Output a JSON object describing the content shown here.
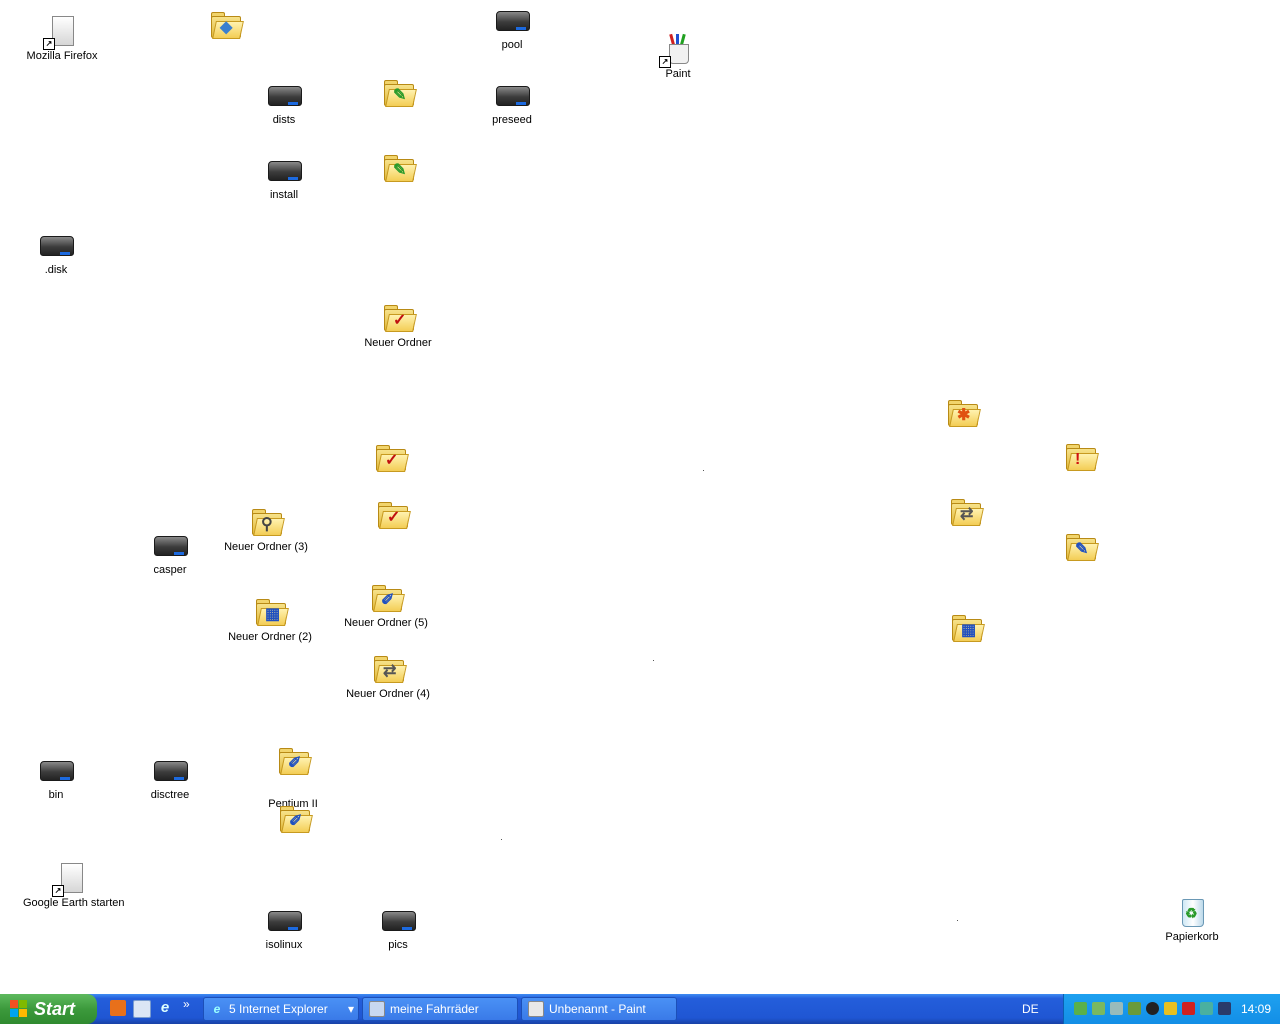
{
  "desktop": {
    "icons": [
      {
        "label": "Mozilla Firefox",
        "kind": "shortcut"
      },
      {
        "label": "",
        "kind": "folder-blue"
      },
      {
        "label": "pool",
        "kind": "drive"
      },
      {
        "label": "Paint",
        "kind": "paint"
      },
      {
        "label": "dists",
        "kind": "drive"
      },
      {
        "label": "",
        "kind": "folder-green"
      },
      {
        "label": "preseed",
        "kind": "drive"
      },
      {
        "label": "install",
        "kind": "drive"
      },
      {
        "label": "",
        "kind": "folder-green"
      },
      {
        "label": ".disk",
        "kind": "drive"
      },
      {
        "label": "Neuer Ordner",
        "kind": "folder-check"
      },
      {
        "label": "",
        "kind": "folder-star"
      },
      {
        "label": "",
        "kind": "folder-error"
      },
      {
        "label": "",
        "kind": "folder-check"
      },
      {
        "label": "",
        "kind": "folder-check"
      },
      {
        "label": "",
        "kind": "folder-network"
      },
      {
        "label": "",
        "kind": "folder-edit"
      },
      {
        "label": "Neuer Ordner (3)",
        "kind": "folder-search"
      },
      {
        "label": "casper",
        "kind": "drive"
      },
      {
        "label": "Neuer Ordner (5)",
        "kind": "folder-pen"
      },
      {
        "label": "Neuer Ordner (2)",
        "kind": "folder-grid"
      },
      {
        "label": "",
        "kind": "folder-grid"
      },
      {
        "label": "Neuer Ordner (4)",
        "kind": "folder-network"
      },
      {
        "label": "bin",
        "kind": "drive"
      },
      {
        "label": "disctree",
        "kind": "drive"
      },
      {
        "label": "Pentium II",
        "kind": "folder-pen"
      },
      {
        "label": "",
        "kind": "folder-pen"
      },
      {
        "label": "Google Earth starten",
        "kind": "shortcut"
      },
      {
        "label": "isolinux",
        "kind": "drive"
      },
      {
        "label": "pics",
        "kind": "drive"
      },
      {
        "label": "Papierkorb",
        "kind": "recycle-bin"
      }
    ]
  },
  "taskbar": {
    "start_label": "Start",
    "quicklaunch_more": "»",
    "tasks": [
      {
        "label": "5 Internet Explorer",
        "dropdown": "▾"
      },
      {
        "label": "meine Fahrräder"
      },
      {
        "label": "Unbenannt - Paint"
      }
    ],
    "language": "DE",
    "clock": "14:09"
  },
  "colors": {
    "taskbar_blue": "#245edb",
    "start_green": "#3c9a3c",
    "tray_blue": "#138ee6"
  }
}
